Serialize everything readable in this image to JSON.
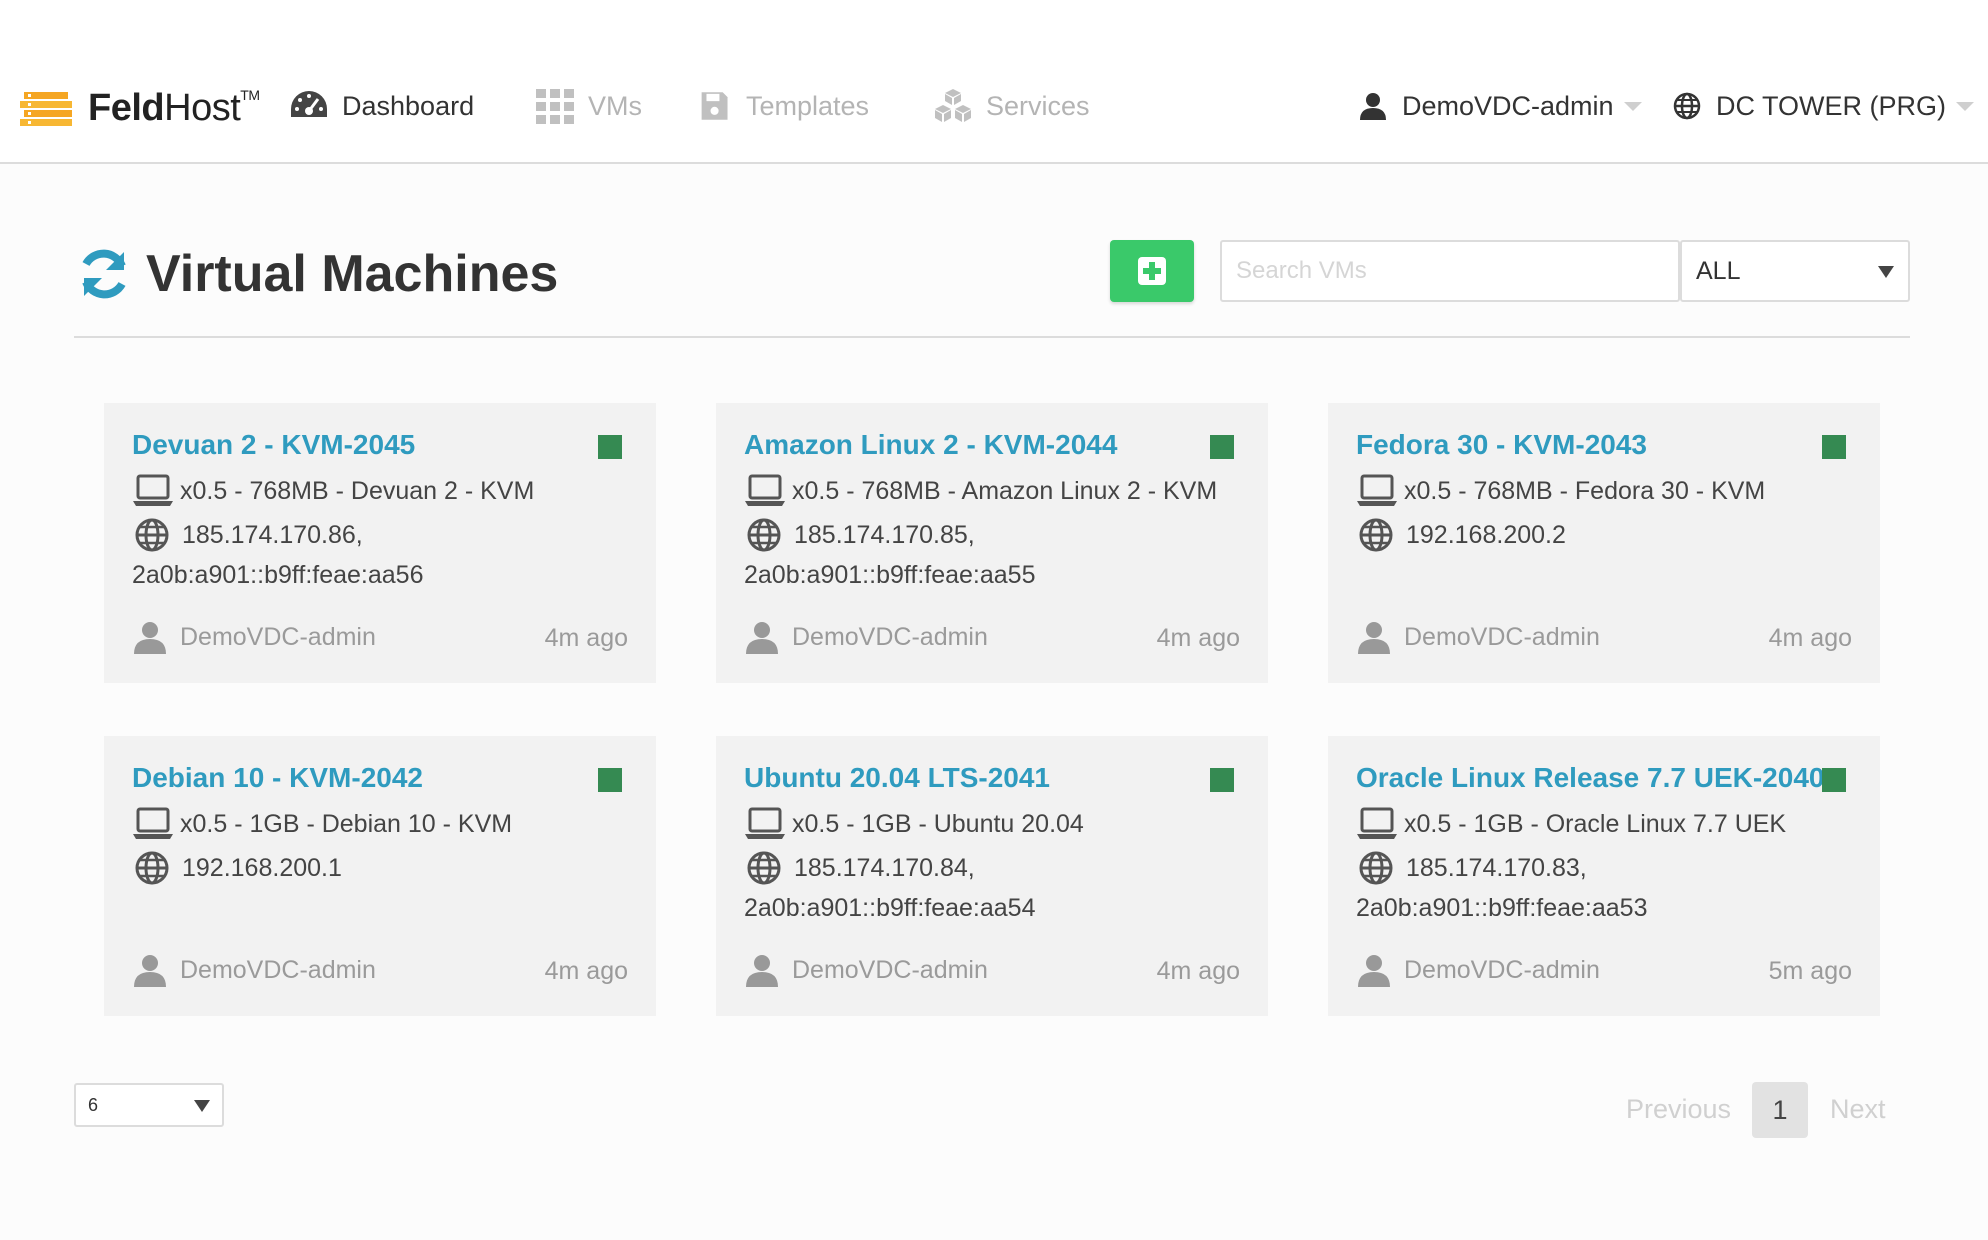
{
  "brand": {
    "name_bold": "Feld",
    "name_regular": "Host",
    "trademark": "TM"
  },
  "nav": {
    "dashboard": "Dashboard",
    "vms": "VMs",
    "templates": "Templates",
    "services": "Services"
  },
  "user": {
    "name": "DemoVDC-admin"
  },
  "datacenter": {
    "name": "DC TOWER (PRG)"
  },
  "page": {
    "title": "Virtual Machines"
  },
  "search": {
    "placeholder": "Search VMs",
    "value": ""
  },
  "filter": {
    "selected": "ALL"
  },
  "colors": {
    "accent": "#2f9bbf",
    "add_button": "#3ac96a",
    "status_running": "#358a52"
  },
  "vms": [
    {
      "name": "Devuan 2 - KVM-2045",
      "spec": "x0.5 - 768MB - Devuan 2 - KVM",
      "ip": "185.174.170.86,",
      "ipv6": "2a0b:a901::b9ff:feae:aa56",
      "owner": "DemoVDC-admin",
      "age": "4m ago"
    },
    {
      "name": "Amazon Linux 2 - KVM-2044",
      "spec": "x0.5 - 768MB - Amazon Linux 2 - KVM",
      "ip": "185.174.170.85,",
      "ipv6": "2a0b:a901::b9ff:feae:aa55",
      "owner": "DemoVDC-admin",
      "age": "4m ago"
    },
    {
      "name": "Fedora 30 - KVM-2043",
      "spec": "x0.5 - 768MB - Fedora 30 - KVM",
      "ip": "192.168.200.2",
      "ipv6": "",
      "owner": "DemoVDC-admin",
      "age": "4m ago"
    },
    {
      "name": "Debian 10 - KVM-2042",
      "spec": "x0.5 - 1GB - Debian 10 - KVM",
      "ip": "192.168.200.1",
      "ipv6": "",
      "owner": "DemoVDC-admin",
      "age": "4m ago"
    },
    {
      "name": "Ubuntu 20.04 LTS-2041",
      "spec": "x0.5 - 1GB - Ubuntu 20.04",
      "ip": "185.174.170.84,",
      "ipv6": "2a0b:a901::b9ff:feae:aa54",
      "owner": "DemoVDC-admin",
      "age": "4m ago"
    },
    {
      "name": "Oracle Linux Release 7.7 UEK-2040",
      "spec": "x0.5 - 1GB - Oracle Linux 7.7 UEK",
      "ip": "185.174.170.83,",
      "ipv6": "2a0b:a901::b9ff:feae:aa53",
      "owner": "DemoVDC-admin",
      "age": "5m ago"
    }
  ],
  "footer": {
    "page_size": "6",
    "previous": "Previous",
    "current_page": "1",
    "next": "Next"
  }
}
